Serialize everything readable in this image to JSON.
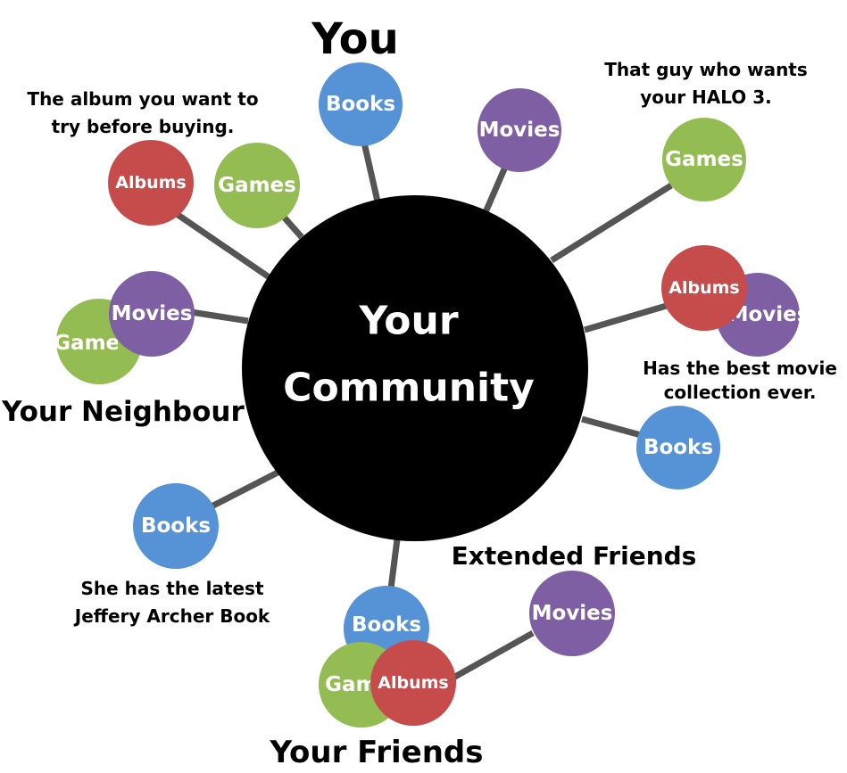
{
  "hub": {
    "line1": "Your",
    "line2": "Community"
  },
  "labels": {
    "you": "You",
    "neighbour": "Your Neighbour",
    "friends": "Your Friends",
    "extended": "Extended Friends"
  },
  "notes": {
    "album": [
      "The album you want to",
      "try before buying."
    ],
    "halo": [
      "That guy who wants",
      "your HALO 3."
    ],
    "movie": [
      "Has the best movie",
      "collection ever."
    ],
    "archer": [
      "She has the latest",
      "Jeffery Archer Book"
    ]
  },
  "colors": {
    "books": "#5592d6",
    "movies": "#7f5fa4",
    "games": "#93bd52",
    "albums": "#c64b4b",
    "hub": "#000000",
    "spoke": "#555555"
  },
  "nodes": {
    "you_books": "Books",
    "you_movies": "Movies",
    "halo_games": "Games",
    "movie_fan_movies": "Movies",
    "movie_fan_albums": "Albums",
    "right_books": "Books",
    "album_albums": "Albums",
    "album_games": "Games",
    "neighbour_games": "Games",
    "neighbour_movies": "Movies",
    "archer_books": "Books",
    "friends_books": "Books",
    "friends_games": "Games",
    "friends_albums": "Albums",
    "extended_movies": "Movies"
  }
}
